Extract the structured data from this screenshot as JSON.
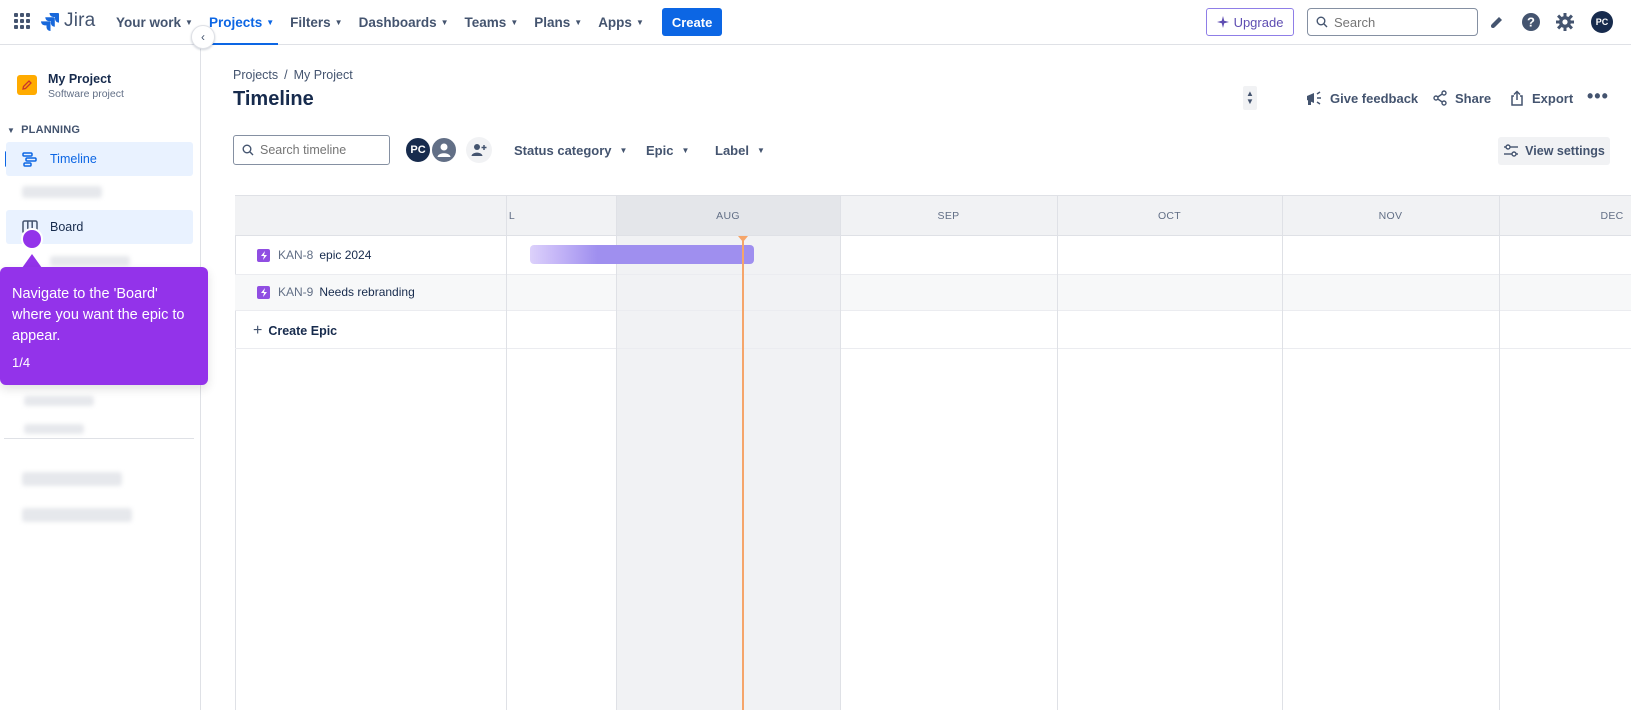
{
  "topnav": {
    "logo_text": "Jira",
    "items": [
      {
        "label": "Your work"
      },
      {
        "label": "Projects"
      },
      {
        "label": "Filters"
      },
      {
        "label": "Dashboards"
      },
      {
        "label": "Teams"
      },
      {
        "label": "Plans"
      },
      {
        "label": "Apps"
      }
    ],
    "active_item": "Projects",
    "create_label": "Create",
    "upgrade_label": "Upgrade",
    "search_placeholder": "Search",
    "avatar_initials": "PC",
    "icons": [
      "app-grid-icon",
      "notifications-icon",
      "help-icon",
      "settings-icon"
    ]
  },
  "sidebar": {
    "project_name": "My Project",
    "project_type": "Software project",
    "section_label": "PLANNING",
    "items": [
      {
        "label": "Timeline",
        "icon": "timeline-icon"
      },
      {
        "label": "Board",
        "icon": "board-icon"
      }
    ]
  },
  "tooltip": {
    "text": "Navigate to the 'Board' where you want the epic to appear.",
    "step": "1/4"
  },
  "header": {
    "breadcrumb": [
      "Projects",
      "/",
      "My Project"
    ],
    "title": "Timeline",
    "actions": {
      "feedback": "Give feedback",
      "share": "Share",
      "export": "Export"
    }
  },
  "filters": {
    "search_placeholder": "Search timeline",
    "avatar_initials": "PC",
    "status_category": "Status category",
    "epic": "Epic",
    "label": "Label",
    "view_settings": "View settings"
  },
  "timeline": {
    "months": [
      "L",
      "AUG",
      "SEP",
      "OCT",
      "NOV",
      "DEC"
    ],
    "epics": [
      {
        "key": "KAN-8",
        "summary": "epic 2024"
      },
      {
        "key": "KAN-9",
        "summary": "Needs rebranding"
      }
    ],
    "create_epic_label": "Create Epic"
  },
  "colors": {
    "primary": "#0c66e4",
    "tooltip": "#9333ea",
    "epic": "#904ee2",
    "epic_bar": "#9f8fef",
    "today": "#f5a56a"
  }
}
